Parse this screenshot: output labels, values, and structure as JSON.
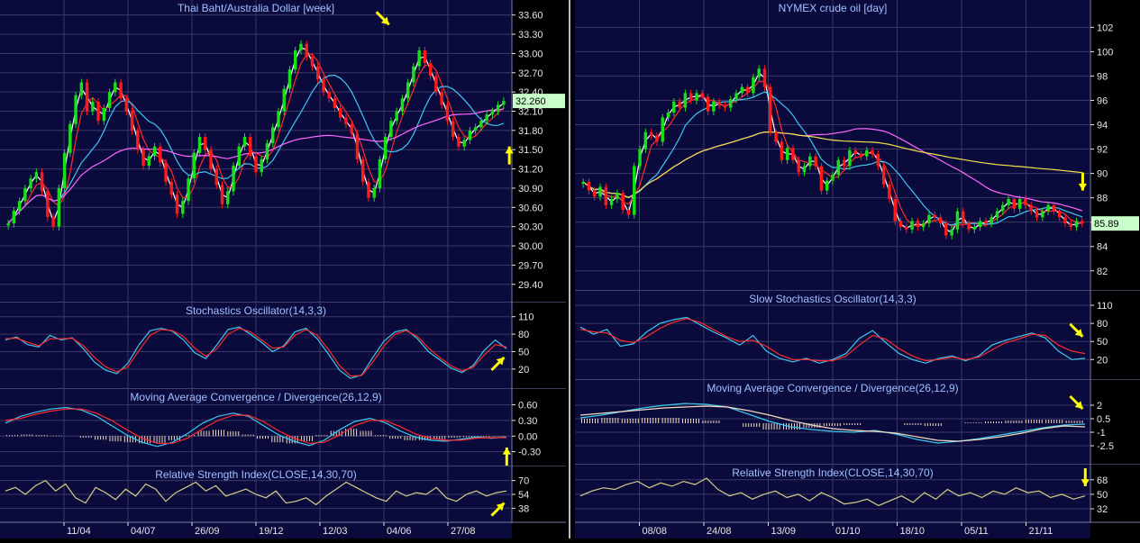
{
  "colors": {
    "background": "#0a0a3c",
    "panel_border": "#7a7aa6",
    "grid": "#3a3a68",
    "title_text": "#9fc0ff",
    "axis_text": "#e6e6e6",
    "bull": "#18e018",
    "bear": "#ff1a1a",
    "white_line": "#ffffff",
    "red_line": "#ff2a2a",
    "cyan_line": "#3ec8f0",
    "magenta_line": "#ff66ff",
    "yellow_line": "#f2e24a",
    "histogram": "#f4dcc0",
    "rsi_line": "#d8cc88",
    "arrow": "#ffff00",
    "price_tag_bg": "#c8ffc8"
  },
  "chart_data": [
    {
      "id": "thb-aud",
      "type": "candlestick",
      "title": "Thai Baht/Australia Dollar [week]",
      "last_price": "32.260",
      "x_ticks": [
        "11/04",
        "04/07",
        "26/09",
        "19/12",
        "12/03",
        "04/06",
        "27/08"
      ],
      "price_axis": {
        "ticks": [
          "33.60",
          "33.30",
          "33.00",
          "32.70",
          "32.40",
          "32.10",
          "31.80",
          "31.50",
          "31.20",
          "30.90",
          "30.60",
          "30.30",
          "30.00",
          "29.70",
          "29.40"
        ],
        "ylim": [
          29.2,
          33.75
        ]
      },
      "close": [
        30.35,
        30.55,
        30.7,
        30.9,
        31.05,
        31.15,
        30.85,
        30.45,
        30.3,
        30.9,
        31.45,
        31.9,
        32.35,
        32.55,
        32.1,
        32.25,
        31.95,
        32.15,
        32.4,
        32.55,
        32.3,
        32.1,
        31.8,
        31.5,
        31.25,
        31.4,
        31.55,
        31.3,
        31.0,
        30.8,
        30.5,
        30.7,
        31.05,
        31.45,
        31.7,
        31.5,
        31.2,
        30.95,
        30.65,
        30.85,
        31.25,
        31.55,
        31.7,
        31.4,
        31.15,
        31.35,
        31.6,
        31.85,
        32.1,
        32.45,
        32.75,
        33.05,
        33.15,
        32.95,
        32.8,
        32.6,
        32.4,
        32.3,
        32.15,
        32.0,
        31.9,
        31.75,
        31.35,
        31.0,
        30.75,
        30.9,
        31.35,
        31.7,
        31.95,
        32.1,
        32.3,
        32.55,
        32.8,
        33.05,
        32.85,
        32.65,
        32.4,
        32.2,
        31.95,
        31.7,
        31.55,
        31.65,
        31.8,
        31.85,
        31.95,
        32.05,
        32.1,
        32.2,
        32.26
      ],
      "overlays": [
        {
          "color_key": "white_line",
          "period": 2
        },
        {
          "color_key": "red_line",
          "period": 4
        },
        {
          "color_key": "cyan_line",
          "period": 10
        },
        {
          "color_key": "magenta_line",
          "period": 40
        }
      ],
      "arrows": [
        {
          "x_frac": 0.76,
          "y_value": 33.45,
          "dir": "down-right"
        },
        {
          "x_frac": 0.995,
          "y_value": 31.55,
          "dir": "up"
        }
      ],
      "indicators": [
        {
          "id": "stoch",
          "title": "Stochastics Oscillator(14,3,3)",
          "type": "line",
          "ticks": [
            "110",
            "80",
            "50",
            "20"
          ],
          "tick_values": [
            110,
            80,
            50,
            20
          ],
          "ylim": [
            -5,
            125
          ],
          "series": [
            {
              "color_key": "cyan_line",
              "values": [
                70,
                75,
                62,
                58,
                78,
                70,
                74,
                55,
                32,
                18,
                12,
                30,
                62,
                86,
                90,
                85,
                70,
                48,
                38,
                62,
                88,
                92,
                80,
                66,
                50,
                60,
                84,
                90,
                72,
                46,
                18,
                4,
                10,
                40,
                68,
                84,
                88,
                72,
                50,
                36,
                22,
                14,
                26,
                52,
                70,
                55
              ]
            },
            {
              "color_key": "red_line",
              "values": [
                72,
                73,
                66,
                60,
                72,
                72,
                73,
                60,
                40,
                24,
                15,
                24,
                52,
                78,
                88,
                86,
                76,
                56,
                42,
                55,
                80,
                90,
                84,
                70,
                56,
                58,
                78,
                88,
                78,
                54,
                26,
                8,
                9,
                32,
                60,
                80,
                86,
                76,
                56,
                40,
                26,
                17,
                23,
                44,
                62,
                58
              ]
            }
          ],
          "arrow": {
            "x_frac": 0.985,
            "y_value": 40,
            "dir": "up-right"
          }
        },
        {
          "id": "macd",
          "title": "Moving Average Convergence / Divergence(26,12,9)",
          "type": "macd",
          "ticks": [
            "0.60",
            "0.30",
            "0.00",
            "-0.30"
          ],
          "tick_values": [
            0.6,
            0.3,
            0.0,
            -0.3
          ],
          "ylim": [
            -0.48,
            0.8
          ],
          "series": [
            {
              "color_key": "cyan_line",
              "values": [
                0.25,
                0.38,
                0.46,
                0.52,
                0.55,
                0.5,
                0.38,
                0.2,
                0.02,
                -0.12,
                -0.2,
                -0.12,
                0.05,
                0.25,
                0.38,
                0.44,
                0.38,
                0.2,
                0.02,
                -0.1,
                -0.18,
                -0.08,
                0.12,
                0.28,
                0.34,
                0.26,
                0.1,
                -0.02,
                -0.08,
                -0.1,
                -0.06,
                -0.02,
                -0.04,
                -0.02
              ]
            },
            {
              "color_key": "red_line",
              "values": [
                0.3,
                0.34,
                0.42,
                0.48,
                0.52,
                0.52,
                0.44,
                0.3,
                0.12,
                -0.04,
                -0.14,
                -0.14,
                -0.04,
                0.14,
                0.3,
                0.4,
                0.4,
                0.28,
                0.1,
                -0.04,
                -0.14,
                -0.12,
                0.02,
                0.2,
                0.3,
                0.3,
                0.18,
                0.04,
                -0.04,
                -0.08,
                -0.08,
                -0.04,
                -0.03,
                -0.03
              ]
            }
          ],
          "histogram_values": [
            0.02,
            0.03,
            0.02,
            0.01,
            0.0,
            -0.03,
            -0.07,
            -0.1,
            -0.12,
            -0.14,
            -0.13,
            -0.08,
            0.02,
            0.1,
            0.12,
            0.09,
            0.03,
            -0.05,
            -0.12,
            -0.14,
            -0.1,
            0.02,
            0.1,
            0.14,
            0.1,
            0.02,
            -0.05,
            -0.08,
            -0.08,
            -0.06,
            -0.03,
            -0.02,
            -0.02,
            -0.01
          ],
          "arrow": {
            "x_frac": 0.99,
            "y_value": -0.22,
            "dir": "up"
          }
        },
        {
          "id": "rsi",
          "title": "Relative Strength Index(CLOSE,14,30,70)",
          "type": "line",
          "ticks": [
            "70",
            "54",
            "38"
          ],
          "tick_values": [
            70,
            54,
            38
          ],
          "ylim": [
            28,
            80
          ],
          "series": [
            {
              "color_key": "rsi_line",
              "values": [
                58,
                62,
                54,
                64,
                70,
                58,
                66,
                50,
                44,
                62,
                56,
                48,
                60,
                52,
                66,
                60,
                46,
                56,
                62,
                68,
                58,
                64,
                52,
                56,
                60,
                54,
                50,
                58,
                44,
                46,
                50,
                42,
                52,
                60,
                68,
                62,
                56,
                50,
                46,
                58,
                52,
                56,
                54,
                62,
                50,
                46,
                54,
                58,
                52,
                56,
                58
              ]
            }
          ],
          "arrow": {
            "x_frac": 0.985,
            "y_value": 44,
            "dir": "up-right"
          }
        }
      ]
    },
    {
      "id": "nymex-crude",
      "type": "candlestick",
      "title": "NYMEX crude oil [day]",
      "last_price": "85.89",
      "x_ticks": [
        "08/08",
        "24/08",
        "13/09",
        "01/10",
        "18/10",
        "05/11",
        "21/11"
      ],
      "price_axis": {
        "ticks": [
          "102",
          "100",
          "98",
          "96",
          "94",
          "92",
          "90",
          "88",
          "86",
          "84",
          "82"
        ],
        "ylim": [
          80.8,
          103.8
        ]
      },
      "close": [
        89.3,
        88.6,
        88.1,
        88.9,
        87.4,
        87.9,
        88.4,
        87.0,
        86.6,
        90.6,
        92.0,
        93.4,
        93.1,
        92.6,
        94.6,
        95.0,
        95.9,
        95.4,
        96.6,
        96.0,
        96.6,
        96.3,
        95.1,
        95.9,
        95.6,
        95.4,
        96.1,
        96.6,
        97.1,
        96.6,
        97.9,
        98.6,
        97.1,
        93.4,
        92.6,
        91.1,
        92.1,
        91.1,
        90.1,
        90.6,
        91.4,
        90.6,
        88.6,
        89.4,
        89.9,
        91.1,
        90.6,
        91.9,
        91.6,
        91.4,
        91.9,
        91.6,
        90.6,
        89.1,
        87.9,
        86.1,
        85.6,
        85.4,
        86.1,
        85.6,
        85.9,
        86.6,
        86.4,
        85.9,
        84.9,
        85.4,
        86.9,
        85.9,
        85.4,
        85.6,
        86.1,
        85.9,
        86.4,
        86.9,
        87.4,
        87.9,
        87.1,
        87.9,
        87.4,
        86.9,
        86.4,
        86.9,
        87.4,
        86.9,
        86.4,
        85.9,
        85.6,
        86.1,
        85.89
      ],
      "overlays": [
        {
          "color_key": "white_line",
          "period": 2
        },
        {
          "color_key": "red_line",
          "period": 4
        },
        {
          "color_key": "cyan_line",
          "period": 10
        },
        {
          "color_key": "magenta_line",
          "period": 40
        },
        {
          "color_key": "yellow_line",
          "period": 100
        }
      ],
      "arrows": [
        {
          "x_frac": 0.985,
          "y_value": 88.6,
          "dir": "down"
        }
      ],
      "indicators": [
        {
          "id": "slowstoch",
          "title": "Slow Stochastics Oscillator(14,3,3)",
          "type": "line",
          "ticks": [
            "110",
            "80",
            "50",
            "20"
          ],
          "tick_values": [
            110,
            80,
            50,
            20
          ],
          "ylim": [
            -5,
            125
          ],
          "series": [
            {
              "color_key": "cyan_line",
              "values": [
                74,
                62,
                70,
                42,
                46,
                66,
                80,
                86,
                90,
                78,
                66,
                56,
                44,
                60,
                34,
                22,
                16,
                22,
                14,
                20,
                30,
                55,
                68,
                48,
                30,
                20,
                14,
                22,
                26,
                18,
                26,
                44,
                52,
                58,
                64,
                56,
                34,
                20,
                22
              ]
            },
            {
              "color_key": "red_line",
              "values": [
                70,
                66,
                64,
                52,
                48,
                58,
                72,
                82,
                88,
                82,
                70,
                58,
                50,
                52,
                42,
                28,
                20,
                20,
                18,
                18,
                26,
                44,
                60,
                54,
                38,
                26,
                18,
                20,
                24,
                20,
                24,
                36,
                48,
                54,
                62,
                60,
                44,
                34,
                30
              ]
            }
          ],
          "arrow": {
            "x_frac": 0.985,
            "y_value": 58,
            "dir": "down-right"
          }
        },
        {
          "id": "macd2",
          "title": "Moving Average Convergence / Divergence(26,12,9)",
          "type": "macd",
          "ticks": [
            "2",
            "0.5",
            "-1",
            "-2.5"
          ],
          "tick_values": [
            2,
            0.5,
            -1,
            -2.5
          ],
          "ylim": [
            -4,
            4.2
          ],
          "series": [
            {
              "color_key": "cyan_line",
              "values": [
                0.6,
                0.9,
                1.3,
                1.7,
                2.0,
                2.2,
                2.1,
                1.8,
                1.0,
                0.2,
                -0.4,
                -0.7,
                -0.9,
                -1.0,
                -0.8,
                -1.2,
                -1.8,
                -2.2,
                -2.0,
                -1.7,
                -1.3,
                -0.9,
                -0.5,
                -0.2,
                -0.1
              ]
            },
            {
              "color_key": "histogram",
              "values": [
                0.9,
                1.1,
                1.3,
                1.5,
                1.7,
                1.8,
                1.9,
                1.8,
                1.4,
                0.9,
                0.3,
                -0.2,
                -0.6,
                -0.8,
                -0.9,
                -1.1,
                -1.5,
                -1.9,
                -2.0,
                -1.8,
                -1.5,
                -1.1,
                -0.6,
                -0.3,
                -0.4
              ]
            }
          ],
          "histogram_values": [
            0.5,
            0.6,
            0.5,
            0.6,
            0.6,
            0.5,
            0.3,
            0.0,
            -0.4,
            -0.7,
            -0.7,
            -0.5,
            -0.3,
            -0.2,
            0.0,
            0.0,
            -0.2,
            -0.3,
            0.0,
            0.1,
            0.2,
            0.3,
            0.4,
            0.4,
            0.3
          ],
          "arrow": {
            "x_frac": 0.985,
            "y_value": 1.6,
            "dir": "down-right"
          }
        },
        {
          "id": "rsi2",
          "title": "Relative Strength Index(CLOSE,14,30,70)",
          "type": "line",
          "ticks": [
            "68",
            "50",
            "32"
          ],
          "tick_values": [
            68,
            50,
            32
          ],
          "ylim": [
            22,
            80
          ],
          "series": [
            {
              "color_key": "rsi_line",
              "values": [
                48,
                54,
                58,
                56,
                62,
                66,
                58,
                64,
                60,
                66,
                62,
                70,
                56,
                48,
                52,
                44,
                50,
                54,
                46,
                50,
                42,
                52,
                46,
                38,
                40,
                44,
                36,
                42,
                48,
                40,
                52,
                44,
                56,
                48,
                52,
                46,
                54,
                50,
                58,
                52,
                54,
                46,
                50,
                44,
                48
              ]
            }
          ],
          "arrow": {
            "x_frac": 0.99,
            "y_value": 60,
            "dir": "down"
          }
        }
      ]
    }
  ]
}
